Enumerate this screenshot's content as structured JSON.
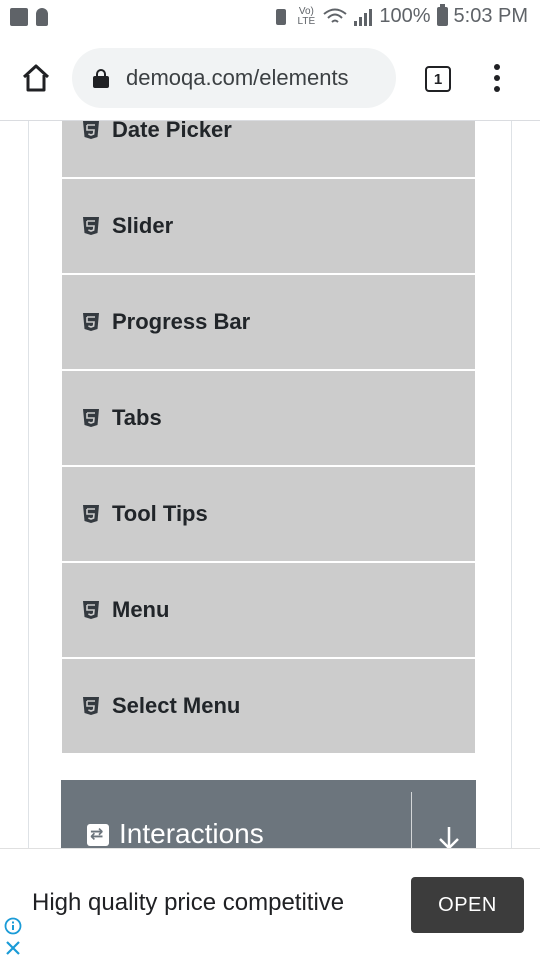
{
  "status_bar": {
    "battery_percent": "100%",
    "time": "5:03 PM",
    "volte_label": "Vo) LTE",
    "icons": [
      "voicemail-icon",
      "person-icon",
      "vibrate-icon",
      "volte-icon",
      "wifi-icon",
      "signal-icon",
      "battery-icon"
    ]
  },
  "browser": {
    "url": "demoqa.com/elements",
    "tab_count": "1",
    "colors": {
      "url_bar_bg": "#f1f3f4"
    }
  },
  "menu": {
    "items": [
      {
        "label": "Date Picker",
        "icon": "html5-icon"
      },
      {
        "label": "Slider",
        "icon": "html5-icon"
      },
      {
        "label": "Progress Bar",
        "icon": "html5-icon"
      },
      {
        "label": "Tabs",
        "icon": "html5-icon"
      },
      {
        "label": "Tool Tips",
        "icon": "html5-icon"
      },
      {
        "label": "Menu",
        "icon": "html5-icon"
      },
      {
        "label": "Select Menu",
        "icon": "html5-icon"
      }
    ],
    "colors": {
      "item_bg": "#cccccc",
      "header_bg": "#6c757d"
    }
  },
  "group": {
    "title": "Interactions",
    "icon": "interactions-icon",
    "toggle_icon": "arrow-down-icon"
  },
  "ad": {
    "text": "High quality price competitive",
    "button": "OPEN"
  }
}
